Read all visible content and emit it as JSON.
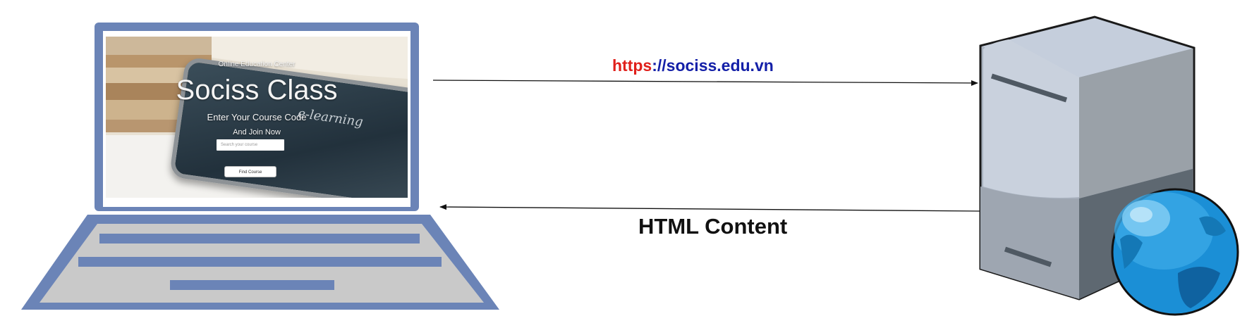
{
  "browser_page": {
    "eyebrow": "Online Education Center",
    "title": "Sociss Class",
    "subtitle": "Enter Your Course Code",
    "join": "And Join Now",
    "search_placeholder": "Search your course",
    "find_button": "Find Course",
    "tablet_text": "e-learning"
  },
  "request": {
    "scheme": "https",
    "separator": "://",
    "host": "sociss.edu.vn",
    "scheme_color": "#e0201b",
    "host_color": "#1420a8"
  },
  "response": {
    "label": "HTML Content"
  },
  "colors": {
    "laptop_frame": "#6b84b7",
    "laptop_body": "#c9c9c9",
    "server_light": "#c4ccd8",
    "globe": "#1b8fd6"
  },
  "icons": {
    "client": "laptop-icon",
    "server": "server-icon",
    "globe": "globe-icon"
  }
}
